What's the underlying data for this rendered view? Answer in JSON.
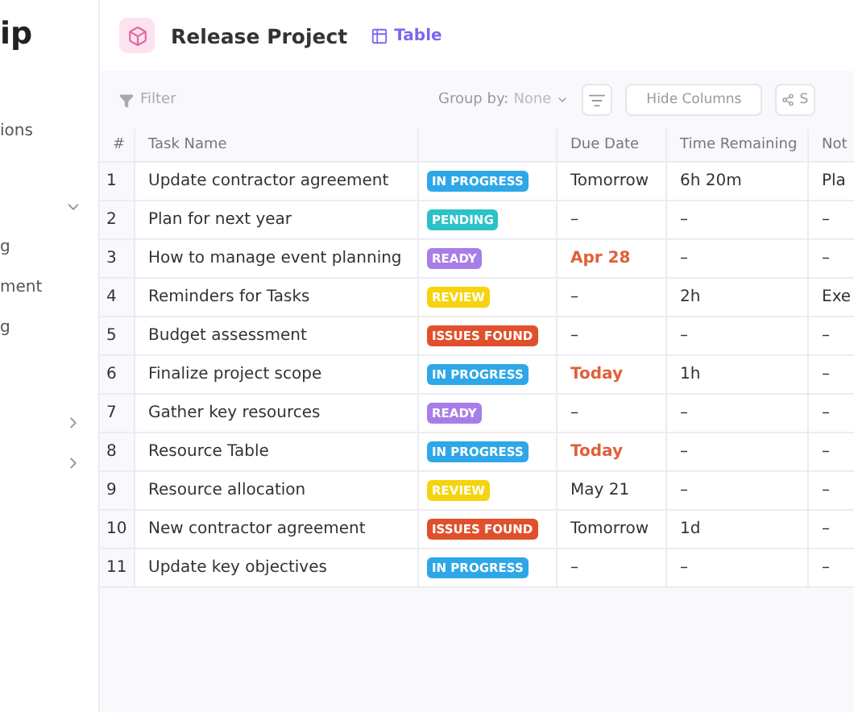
{
  "sidebar": {
    "logo_text": "ip",
    "items": [
      {
        "label": "ions",
        "kind": "text"
      },
      {
        "kind": "chevron-down"
      },
      {
        "label": "g",
        "kind": "text"
      },
      {
        "label": "ment",
        "kind": "text"
      },
      {
        "label": "g",
        "kind": "text"
      },
      {
        "kind": "chevron-right"
      },
      {
        "kind": "chevron-right"
      }
    ]
  },
  "header": {
    "title": "Release Project",
    "view_tab": {
      "label": "Table",
      "selected": true
    }
  },
  "toolbar": {
    "filter": {
      "placeholder": "Filter"
    },
    "group_by": {
      "label": "Group by:",
      "value": "None"
    },
    "hide_columns": "Hide Columns",
    "share": "S"
  },
  "table": {
    "columns": [
      "#",
      "Task Name",
      "",
      "Due Date",
      "Time Remaining",
      "Not"
    ],
    "rows": [
      {
        "num": "1",
        "task": "Update contractor agreement",
        "status": {
          "label": "IN PROGRESS",
          "color": "#2ea7e8"
        },
        "due": "Tomorrow",
        "due_highlight": false,
        "time": "6h 20m",
        "notes": "Pla"
      },
      {
        "num": "2",
        "task": "Plan for next year",
        "status": {
          "label": "PENDING",
          "color": "#2cc2c7"
        },
        "due": "–",
        "due_highlight": false,
        "time": "–",
        "notes": "–"
      },
      {
        "num": "3",
        "task": "How to manage event planning",
        "status": {
          "label": "READY",
          "color": "#a77ee8"
        },
        "due": "Apr 28",
        "due_highlight": true,
        "time": "–",
        "notes": "–"
      },
      {
        "num": "4",
        "task": "Reminders for Tasks",
        "status": {
          "label": "REVIEW",
          "color": "#f5d40f"
        },
        "due": "–",
        "due_highlight": false,
        "time": "2h",
        "notes": "Exe"
      },
      {
        "num": "5",
        "task": "Budget assessment",
        "status": {
          "label": "ISSUES FOUND",
          "color": "#e0502c"
        },
        "due": "–",
        "due_highlight": false,
        "time": "–",
        "notes": "–"
      },
      {
        "num": "6",
        "task": "Finalize project  scope",
        "status": {
          "label": "IN PROGRESS",
          "color": "#2ea7e8"
        },
        "due": "Today",
        "due_highlight": true,
        "time": "1h",
        "notes": "–"
      },
      {
        "num": "7",
        "task": "Gather key resources",
        "status": {
          "label": "READY",
          "color": "#a77ee8"
        },
        "due": "–",
        "due_highlight": false,
        "time": "–",
        "notes": "–"
      },
      {
        "num": "8",
        "task": "Resource Table",
        "status": {
          "label": "IN PROGRESS",
          "color": "#2ea7e8"
        },
        "due": "Today",
        "due_highlight": true,
        "time": "–",
        "notes": "–"
      },
      {
        "num": "9",
        "task": "Resource allocation",
        "status": {
          "label": "REVIEW",
          "color": "#f5d40f"
        },
        "due": "May 21",
        "due_highlight": false,
        "time": "–",
        "notes": "–"
      },
      {
        "num": "10",
        "task": "New contractor agreement",
        "status": {
          "label": "ISSUES FOUND",
          "color": "#e0502c"
        },
        "due": "Tomorrow",
        "due_highlight": false,
        "time": "1d",
        "notes": "–"
      },
      {
        "num": "11",
        "task": "Update key objectives",
        "status": {
          "label": "IN PROGRESS",
          "color": "#2ea7e8"
        },
        "due": "–",
        "due_highlight": false,
        "time": "–",
        "notes": "–"
      }
    ]
  }
}
